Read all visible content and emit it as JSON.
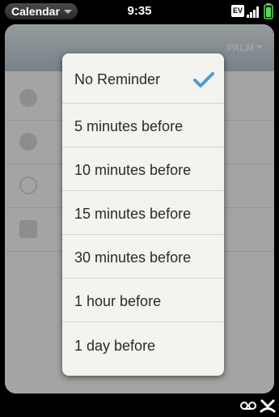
{
  "status_bar": {
    "app_name": "Calendar",
    "time": "9:35",
    "network": "EV"
  },
  "app_card": {
    "calendar_name": "PALM"
  },
  "reminder_menu": {
    "items": [
      {
        "label": "No Reminder",
        "selected": true
      },
      {
        "label": "5 minutes before",
        "selected": false
      },
      {
        "label": "10 minutes before",
        "selected": false
      },
      {
        "label": "15 minutes before",
        "selected": false
      },
      {
        "label": "30 minutes before",
        "selected": false
      },
      {
        "label": "1 hour before",
        "selected": false
      },
      {
        "label": "1 day before",
        "selected": false
      }
    ]
  },
  "colors": {
    "accent_check": "#4a9fd8",
    "header": "#9fb2bd",
    "battery": "#5ad85a"
  }
}
